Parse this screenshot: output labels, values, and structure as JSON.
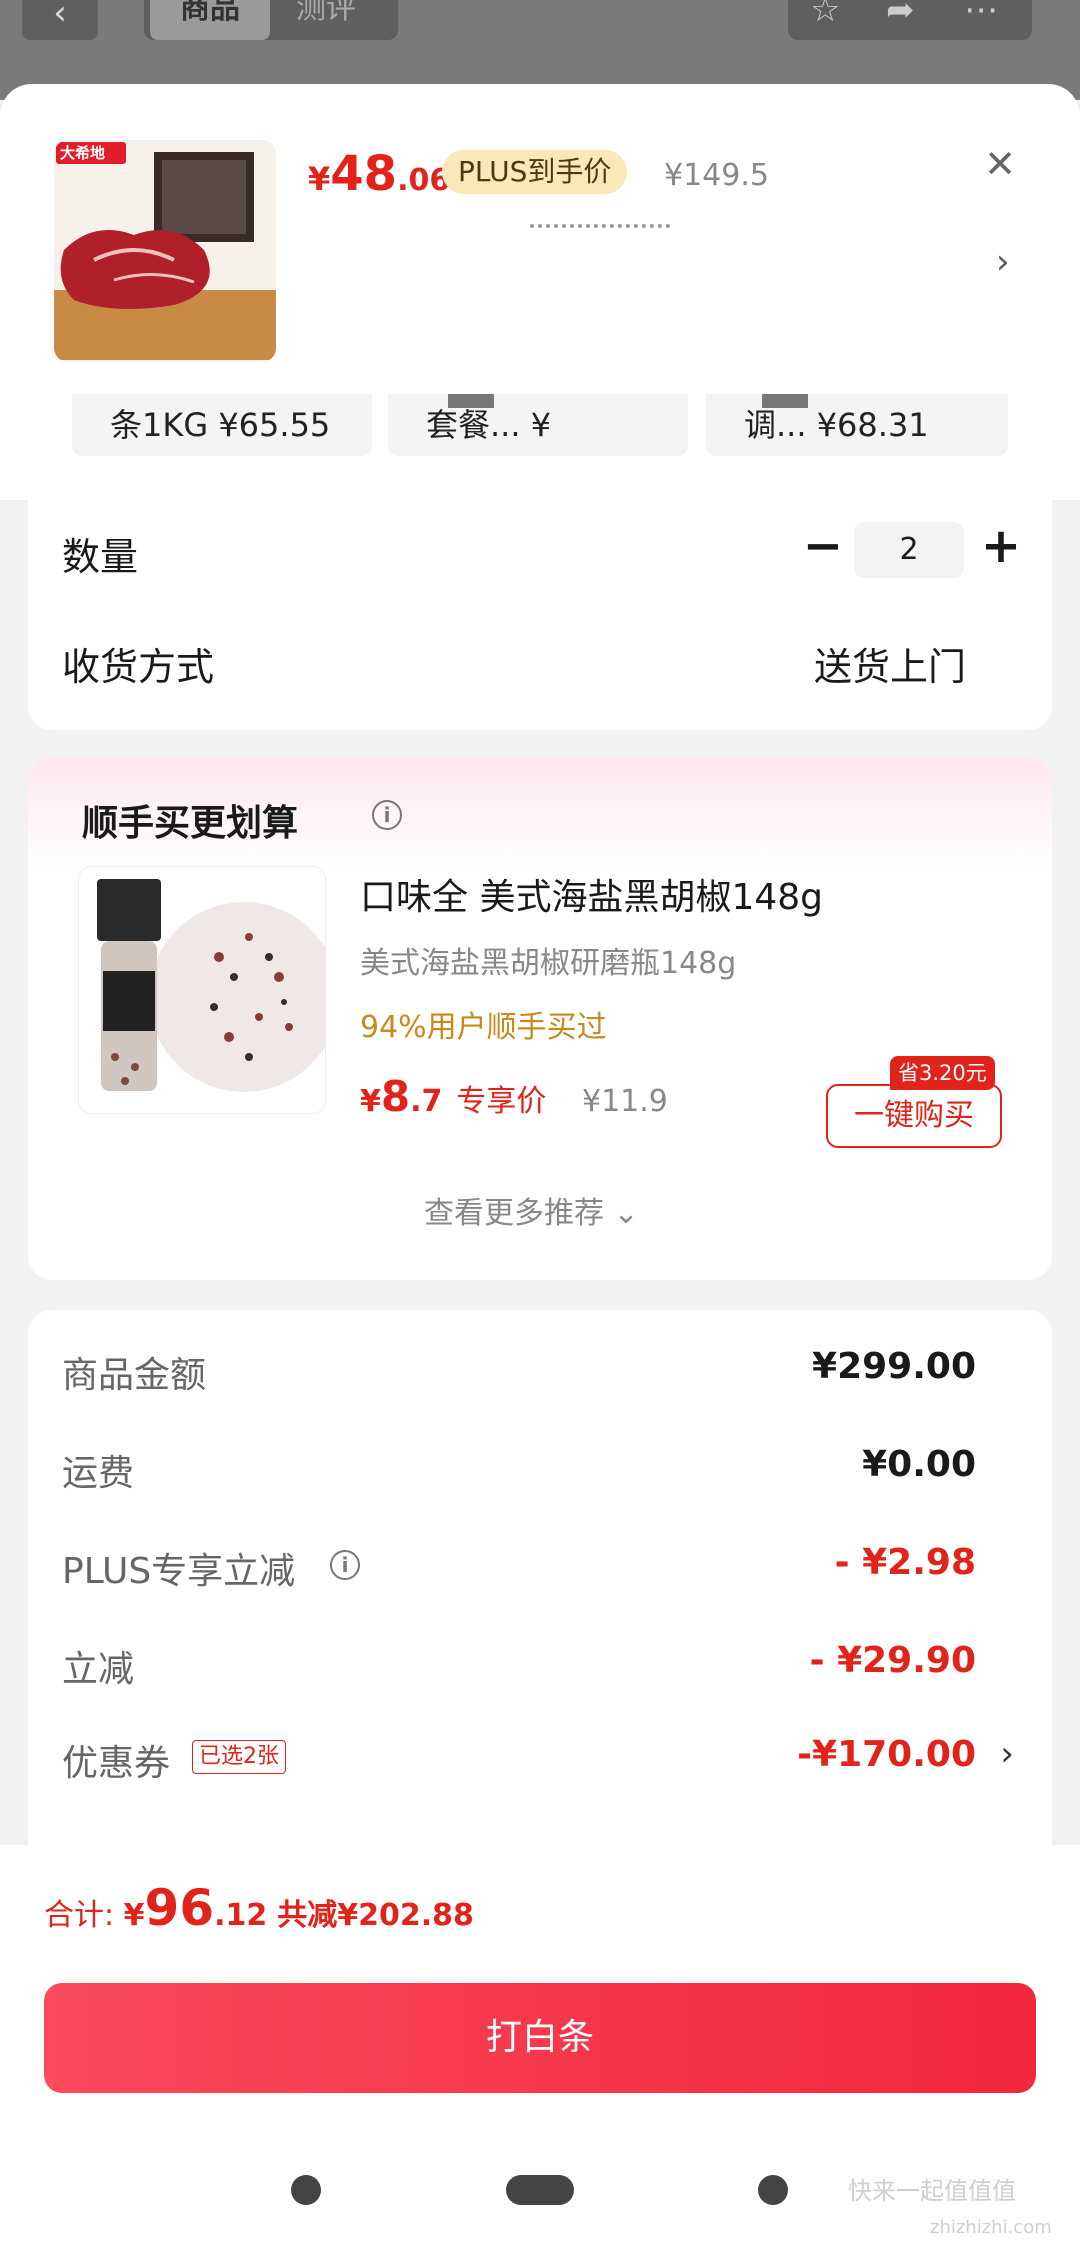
{
  "topbar": {
    "back_icon": "‹",
    "tab_active": "商品",
    "tab_inactive": "测评"
  },
  "product": {
    "price_symbol": "¥",
    "price_int": "48",
    "price_dec": ".06",
    "plus_badge": "PLUS到手价",
    "orig_price": "¥149.5",
    "image_brand": "大希地"
  },
  "specs": [
    {
      "label": "条1KG ¥65.55"
    },
    {
      "label": "套餐... ¥"
    },
    {
      "label": "调... ¥68.31"
    }
  ],
  "quantity": {
    "label": "数量",
    "value": "2"
  },
  "delivery": {
    "label": "收货方式",
    "value": "送货上门"
  },
  "recommend": {
    "title": "顺手买更划算",
    "name": "口味全 美式海盐黑胡椒148g",
    "subtitle": "美式海盐黑胡椒研磨瓶148g",
    "hint": "94%用户顺手买过",
    "price_symbol": "¥",
    "price_int": "8",
    "price_dec": ".7",
    "price_tag": "专享价",
    "orig_price": "¥11.9",
    "save_badge": "省3.20元",
    "buy_label": "一键购买",
    "more_label": "查看更多推荐 ⌄"
  },
  "summary": {
    "rows": [
      {
        "label": "商品金额",
        "value": "¥299.00"
      },
      {
        "label": "运费",
        "value": "¥0.00"
      },
      {
        "label": "PLUS专享立减",
        "value": "- ¥2.98"
      },
      {
        "label": "立减",
        "value": "- ¥29.90"
      },
      {
        "label": "优惠券",
        "value": "-¥170.00",
        "badge": "已选2张"
      }
    ]
  },
  "footer": {
    "total_label": "合计: ",
    "total_symbol": "¥",
    "total_int": "96",
    "total_dec": ".12",
    "saved": "共减¥202.88",
    "pay_label": "打白条"
  },
  "watermark": {
    "text": "快来一起值值值",
    "url": "zhizhizhi.com"
  },
  "colors": {
    "accent": "#e2231a",
    "pay_button": "#f2273b",
    "plus_badge": "#fbe8b8",
    "hint": "#c88a1a"
  }
}
